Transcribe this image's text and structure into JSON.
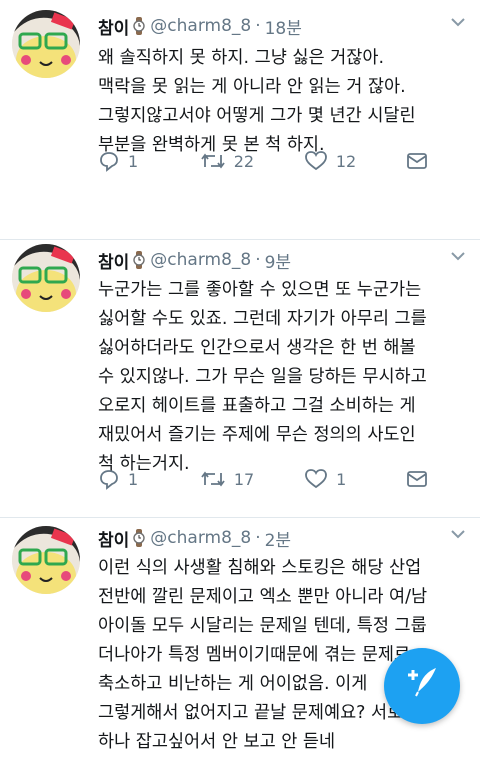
{
  "colors": {
    "accent": "#1da1f2",
    "secondary_text": "#657786",
    "primary_text": "#14171a"
  },
  "tweets": [
    {
      "name": "참이",
      "handle": "@charm8_8",
      "time": "18분",
      "lines": [
        "왜 솔직하지 못 하지. 그냥 싫은 거잖아.",
        "맥락을 못 읽는 게 아니라 안 읽는 거 잖아.",
        "그렇지않고서야 어떻게 그가 몇 년간 시달린",
        "부분을 완벽하게 못 본 척 하지."
      ],
      "replies": "1",
      "retweets": "22",
      "likes": "12"
    },
    {
      "name": "참이",
      "handle": "@charm8_8",
      "time": "9분",
      "lines": [
        "누군가는 그를 좋아할 수 있으면 또 누군가는",
        "싫어할 수도 있죠. 그런데 자기가 아무리 그를",
        "싫어하더라도 인간으로서 생각은 한 번 해볼",
        "수 있지않나. 그가 무슨 일을 당하든 무시하고",
        "오로지 헤이트를 표출하고 그걸 소비하는 게",
        "재밌어서 즐기는 주제에 무슨 정의의 사도인",
        "척 하는거지."
      ],
      "replies": "1",
      "retweets": "17",
      "likes": "1"
    },
    {
      "name": "참이",
      "handle": "@charm8_8",
      "time": "2분",
      "lines": [
        "이런 식의 사생활 침해와 스토킹은 해당 산업",
        "전반에 깔린 문제이고 엑소 뿐만 아니라 여/남",
        "아이돌 모두 시달리는 문제일 텐데, 특정 그룹",
        "더나아가 특정 멤버이기때문에 겪는 문제로",
        "축소하고 비난하는 게 어이없음. 이게",
        "그렇게해서 없어지고 끝날 문제예요? 서로",
        "하나 잡고싶어서 안 보고 안 듣네"
      ]
    }
  ],
  "icons": {
    "verified_badge": "watch-emoji-icon",
    "menu": "chevron-down-icon",
    "reply": "reply-icon",
    "retweet": "retweet-icon",
    "like": "heart-icon",
    "dm": "envelope-icon",
    "compose": "compose-tweet-icon"
  }
}
